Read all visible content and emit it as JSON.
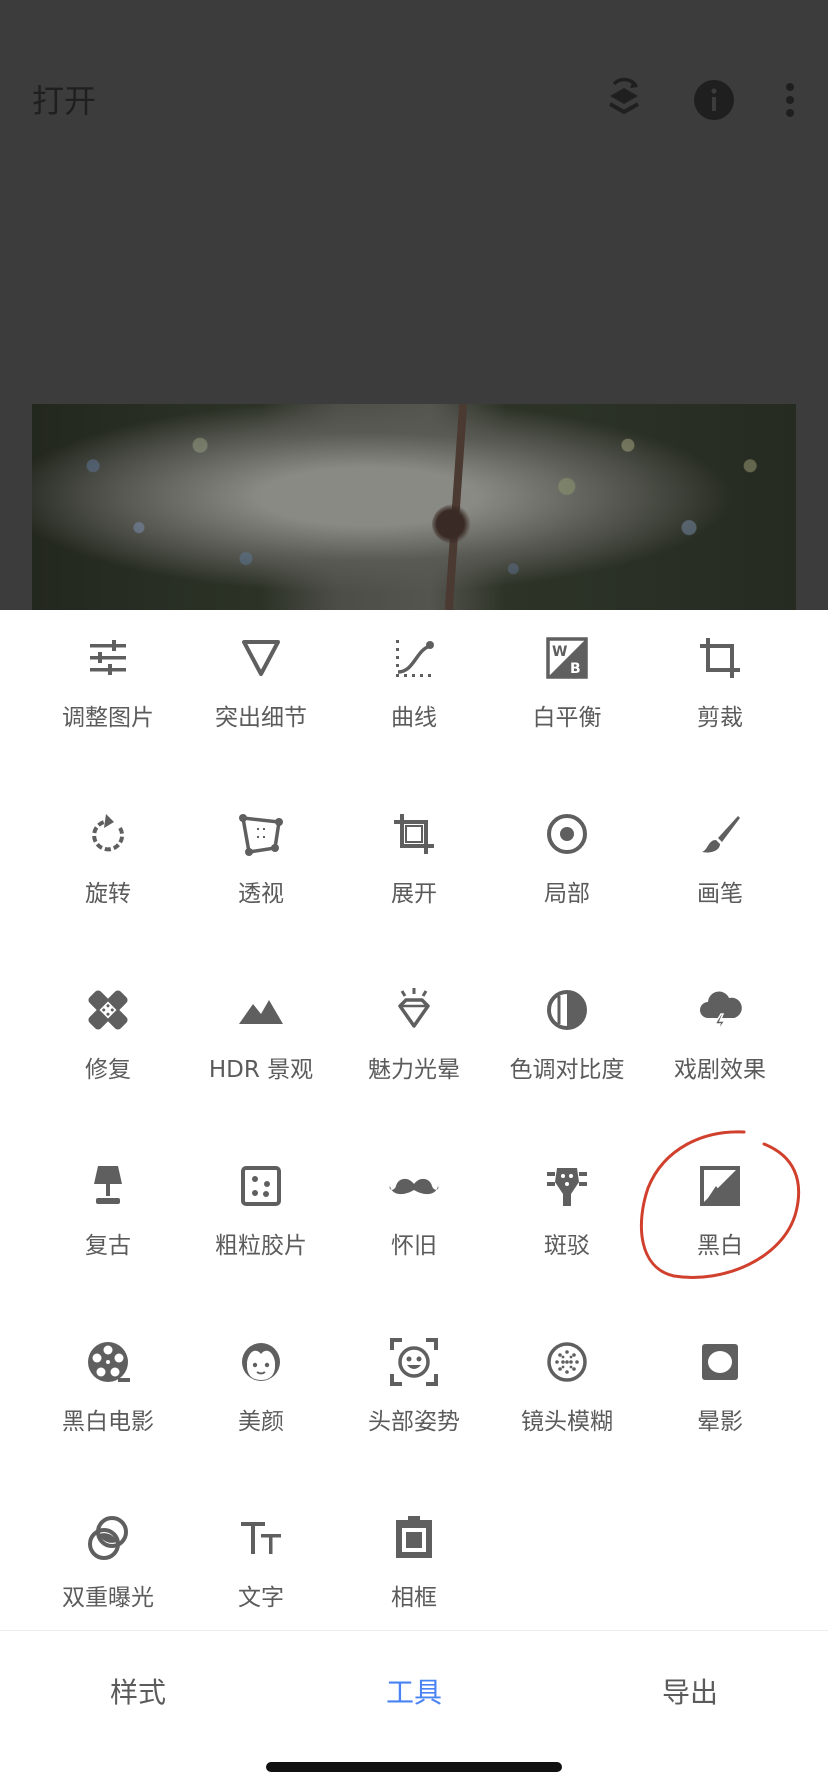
{
  "header": {
    "open_label": "打开"
  },
  "tools": [
    {
      "label": "调整图片",
      "icon": "sliders-icon"
    },
    {
      "label": "突出细节",
      "icon": "triangle-down-icon"
    },
    {
      "label": "曲线",
      "icon": "curves-icon"
    },
    {
      "label": "白平衡",
      "icon": "white-balance-icon"
    },
    {
      "label": "剪裁",
      "icon": "crop-icon"
    },
    {
      "label": "旋转",
      "icon": "rotate-icon"
    },
    {
      "label": "透视",
      "icon": "perspective-icon"
    },
    {
      "label": "展开",
      "icon": "expand-icon"
    },
    {
      "label": "局部",
      "icon": "selective-target-icon"
    },
    {
      "label": "画笔",
      "icon": "brush-icon"
    },
    {
      "label": "修复",
      "icon": "healing-bandage-icon"
    },
    {
      "label": "HDR 景观",
      "icon": "mountains-icon"
    },
    {
      "label": "魅力光晕",
      "icon": "diamond-glow-icon"
    },
    {
      "label": "色调对比度",
      "icon": "tonal-contrast-icon"
    },
    {
      "label": "戏剧效果",
      "icon": "storm-cloud-icon"
    },
    {
      "label": "复古",
      "icon": "lamp-icon"
    },
    {
      "label": "粗粒胶片",
      "icon": "grain-dice-icon"
    },
    {
      "label": "怀旧",
      "icon": "mustache-icon"
    },
    {
      "label": "斑驳",
      "icon": "guitar-head-icon"
    },
    {
      "label": "黑白",
      "icon": "black-white-icon"
    },
    {
      "label": "黑白电影",
      "icon": "film-reel-icon"
    },
    {
      "label": "美颜",
      "icon": "face-icon"
    },
    {
      "label": "头部姿势",
      "icon": "face-frame-icon"
    },
    {
      "label": "镜头模糊",
      "icon": "lens-blur-icon"
    },
    {
      "label": "晕影",
      "icon": "vignette-icon"
    },
    {
      "label": "双重曝光",
      "icon": "double-exposure-icon"
    },
    {
      "label": "文字",
      "icon": "text-icon"
    },
    {
      "label": "相框",
      "icon": "frame-icon"
    }
  ],
  "bottom_nav": {
    "styles": "样式",
    "tools": "工具",
    "export": "导出",
    "active": "tools"
  },
  "colors": {
    "icon": "#5f5f5f",
    "active_tab": "#4a84f4",
    "annotation": "#d0402c"
  }
}
